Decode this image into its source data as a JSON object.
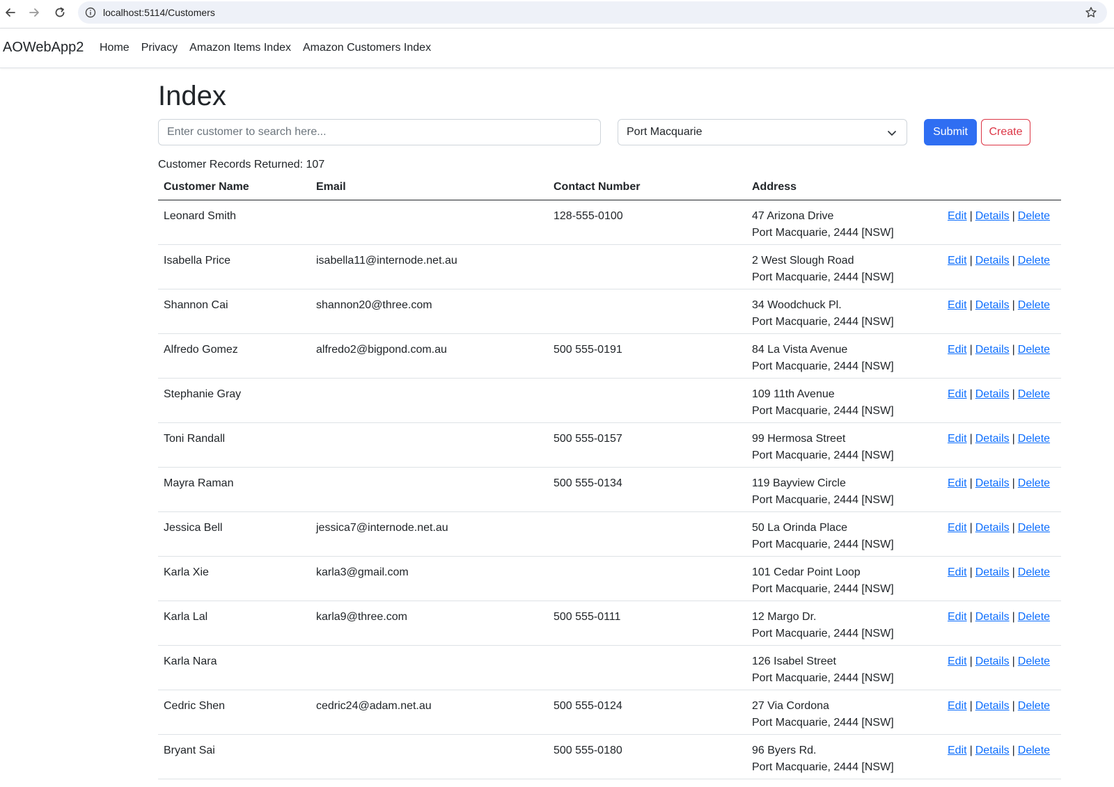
{
  "browser": {
    "url": "localhost:5114/Customers"
  },
  "navbar": {
    "brand": "AOWebApp2",
    "links": [
      "Home",
      "Privacy",
      "Amazon Items Index",
      "Amazon Customers Index"
    ]
  },
  "page": {
    "title": "Index",
    "search_placeholder": "Enter customer to search here...",
    "search_value": "",
    "suburb_selected": "Port Macquarie",
    "submit_label": "Submit",
    "create_label": "Create",
    "records_text": "Customer Records Returned: 107"
  },
  "table": {
    "headers": [
      "Customer Name",
      "Email",
      "Contact Number",
      "Address"
    ],
    "action_labels": {
      "edit": "Edit",
      "details": "Details",
      "delete": "Delete",
      "separator": "|"
    },
    "rows": [
      {
        "name": "Leonard Smith",
        "email": "",
        "phone": "128-555-0100",
        "street": "47 Arizona Drive",
        "locality": "Port Macquarie, 2444 [NSW]"
      },
      {
        "name": "Isabella Price",
        "email": "isabella11@internode.net.au",
        "phone": "",
        "street": "2 West Slough Road",
        "locality": "Port Macquarie, 2444 [NSW]"
      },
      {
        "name": "Shannon Cai",
        "email": "shannon20@three.com",
        "phone": "",
        "street": "34 Woodchuck Pl.",
        "locality": "Port Macquarie, 2444 [NSW]"
      },
      {
        "name": "Alfredo Gomez",
        "email": "alfredo2@bigpond.com.au",
        "phone": "500 555-0191",
        "street": "84 La Vista Avenue",
        "locality": "Port Macquarie, 2444 [NSW]"
      },
      {
        "name": "Stephanie Gray",
        "email": "",
        "phone": "",
        "street": "109 11th Avenue",
        "locality": "Port Macquarie, 2444 [NSW]"
      },
      {
        "name": "Toni Randall",
        "email": "",
        "phone": "500 555-0157",
        "street": "99 Hermosa Street",
        "locality": "Port Macquarie, 2444 [NSW]"
      },
      {
        "name": "Mayra Raman",
        "email": "",
        "phone": "500 555-0134",
        "street": "119 Bayview Circle",
        "locality": "Port Macquarie, 2444 [NSW]"
      },
      {
        "name": "Jessica Bell",
        "email": "jessica7@internode.net.au",
        "phone": "",
        "street": "50 La Orinda Place",
        "locality": "Port Macquarie, 2444 [NSW]"
      },
      {
        "name": "Karla Xie",
        "email": "karla3@gmail.com",
        "phone": "",
        "street": "101 Cedar Point Loop",
        "locality": "Port Macquarie, 2444 [NSW]"
      },
      {
        "name": "Karla Lal",
        "email": "karla9@three.com",
        "phone": "500 555-0111",
        "street": "12 Margo Dr.",
        "locality": "Port Macquarie, 2444 [NSW]"
      },
      {
        "name": "Karla Nara",
        "email": "",
        "phone": "",
        "street": "126 Isabel Street",
        "locality": "Port Macquarie, 2444 [NSW]"
      },
      {
        "name": "Cedric Shen",
        "email": "cedric24@adam.net.au",
        "phone": "500 555-0124",
        "street": "27 Via Cordona",
        "locality": "Port Macquarie, 2444 [NSW]"
      },
      {
        "name": "Bryant Sai",
        "email": "",
        "phone": "500 555-0180",
        "street": "96 Byers Rd.",
        "locality": "Port Macquarie, 2444 [NSW]"
      }
    ]
  },
  "icons": {
    "back": "arrow-left-icon",
    "forward": "arrow-right-icon",
    "reload": "reload-icon",
    "site_info": "info-icon",
    "bookmark": "star-icon",
    "dropdown": "chevron-down-icon"
  },
  "colors": {
    "primary": "#2f6ef2",
    "danger": "#dc3545",
    "link": "#0d6efd"
  }
}
